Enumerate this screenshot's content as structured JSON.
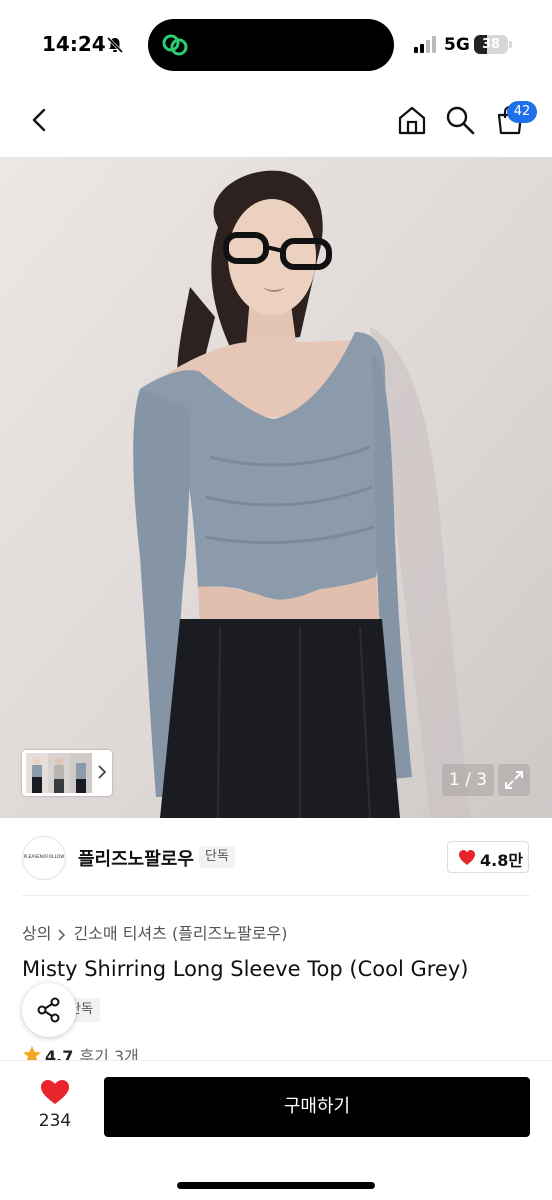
{
  "status_bar": {
    "time": "14:24",
    "network": "5G",
    "battery": "38",
    "battery_level": 0.38
  },
  "nav": {
    "cart_badge": "42",
    "badge_color": "#1f6feb"
  },
  "gallery": {
    "page_counter": "1 / 3"
  },
  "seller": {
    "name": "플리즈노팔로우",
    "tag": "단독",
    "logo_text": "PLEASENOFOLLOW",
    "likes": "4.8만"
  },
  "product": {
    "breadcrumb": [
      "상의",
      "긴소매 티셔츠 (플리즈노팔로우)"
    ],
    "title": "Misty Shirring Long Sleeve Top (Cool Grey)",
    "exclusive_tag": "단독",
    "rating": "4.7",
    "reviews": "후기 3개"
  },
  "bottom_bar": {
    "wish_count": "234",
    "buy_label": "구매하기"
  },
  "colors": {
    "heart": "#e8242c",
    "star": "#f5a623",
    "buy_button": "#000000"
  }
}
